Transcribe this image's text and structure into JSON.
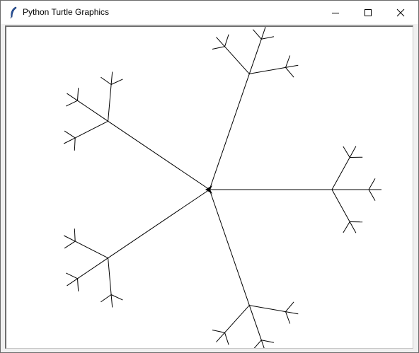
{
  "window": {
    "title": "Python Turtle Graphics",
    "title_icon": "feather-icon",
    "controls": {
      "minimize_icon": "minimize-icon",
      "maximize_icon": "maximize-icon",
      "close_icon": "close-icon"
    }
  },
  "canvas": {
    "background": "#ffffff",
    "pen_color": "#000000",
    "turtle_shape": "classic-arrow",
    "turtle_heading_deg": 180
  }
}
